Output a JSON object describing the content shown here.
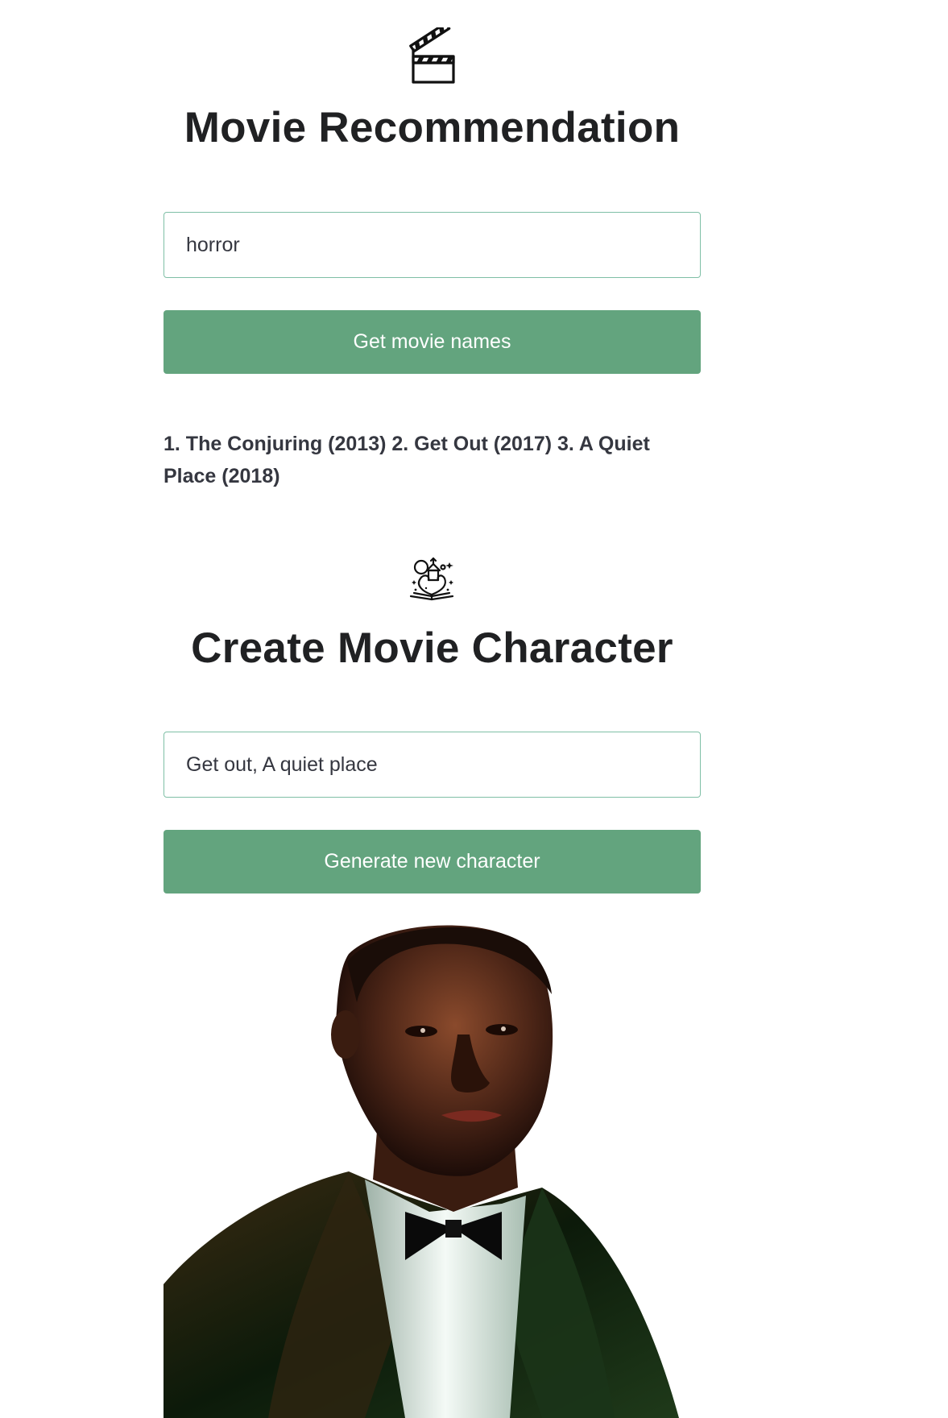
{
  "recommendation": {
    "icon": "clapperboard-icon",
    "title": "Movie Recommendation",
    "input_value": "horror",
    "button_label": "Get movie names",
    "result": "1. The Conjuring (2013) 2. Get Out (2017) 3. A Quiet Place (2018)"
  },
  "character": {
    "icon": "magic-storybook-icon",
    "title": "Create Movie Character",
    "input_value": "Get out, A quiet place",
    "button_label": "Generate new character",
    "image": "generated-character-portrait"
  },
  "colors": {
    "accent": "#63a47e",
    "input_border": "#7fbfa6",
    "title": "#202123",
    "text": "#353740"
  }
}
